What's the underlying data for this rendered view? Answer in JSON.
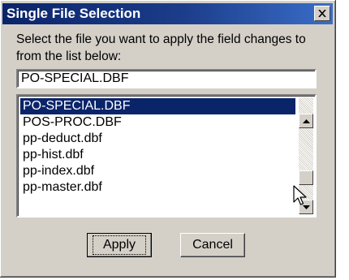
{
  "dialog": {
    "title": "Single File Selection",
    "close_icon": "close-icon",
    "instruction": "Select the file you want to apply the field changes to from the list below:",
    "file_field": {
      "value": "PO-SPECIAL.DBF"
    },
    "file_list": {
      "items": [
        "PO-SPECIAL.DBF",
        "POS-PROC.DBF",
        "pp-deduct.dbf",
        "pp-hist.dbf",
        "pp-index.dbf",
        "pp-master.dbf"
      ],
      "selected": "PO-SPECIAL.DBF"
    },
    "buttons": {
      "apply": "Apply",
      "cancel": "Cancel"
    }
  },
  "colors": {
    "titlebar": "#0a246a",
    "face": "#d4d0c8",
    "selection": "#0a246a"
  }
}
